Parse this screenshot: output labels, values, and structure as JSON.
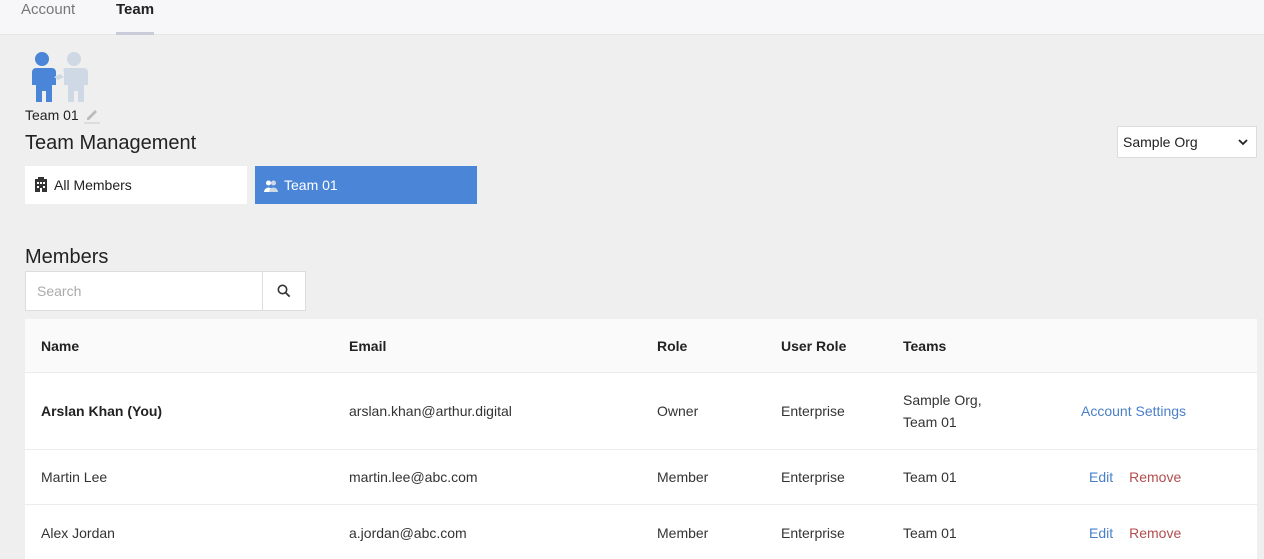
{
  "nav": {
    "tabs": [
      {
        "label": "Account"
      },
      {
        "label": "Team"
      }
    ]
  },
  "team": {
    "name": "Team 01"
  },
  "team_management": {
    "title": "Team Management",
    "tabs": [
      {
        "label": "All Members",
        "icon": "building-icon"
      },
      {
        "label": "Team 01",
        "icon": "team-icon"
      }
    ],
    "org_select": {
      "selected": "Sample Org"
    }
  },
  "members": {
    "title": "Members",
    "search": {
      "placeholder": "Search",
      "value": ""
    },
    "columns": [
      "Name",
      "Email",
      "Role",
      "User Role",
      "Teams"
    ],
    "rows": [
      {
        "name": "Arslan Khan (You)",
        "email": "arslan.khan@arthur.digital",
        "role": "Owner",
        "user_role": "Enterprise",
        "teams_line1": "Sample Org,",
        "teams_line2": "Team 01",
        "action": "Account Settings"
      },
      {
        "name": "Martin Lee",
        "email": "martin.lee@abc.com",
        "role": "Member",
        "user_role": "Enterprise",
        "teams": "Team 01",
        "edit": "Edit",
        "remove": "Remove"
      },
      {
        "name": "Alex Jordan",
        "email": "a.jordan@abc.com",
        "role": "Member",
        "user_role": "Enterprise",
        "teams": "Team 01",
        "edit": "Edit",
        "remove": "Remove"
      }
    ]
  },
  "colors": {
    "accent": "#4a85d8",
    "link": "#4a7fc9",
    "danger": "#b24d4d",
    "background": "#efefef"
  }
}
